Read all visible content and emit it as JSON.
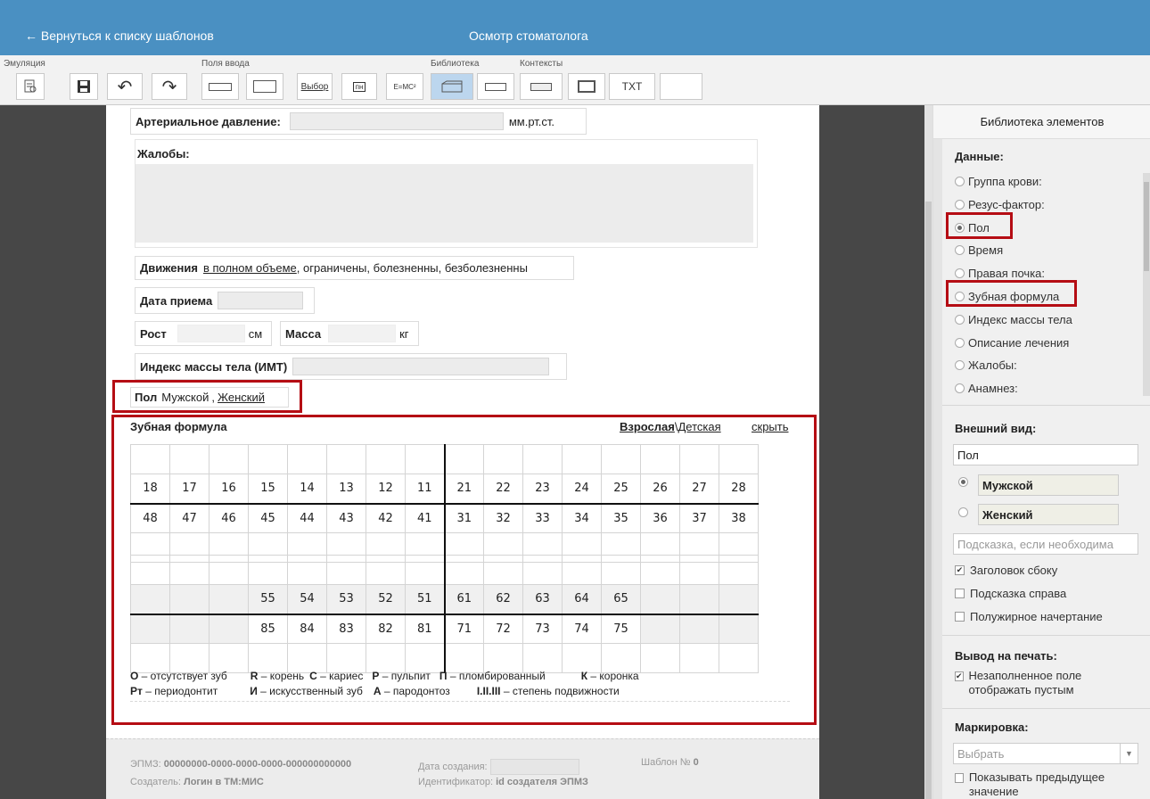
{
  "header": {
    "back_label": "← Вернуться к списку шаблонов",
    "title": "Осмотр стоматолога"
  },
  "toolbar": {
    "groups": {
      "emulation": "Эмуляция",
      "fields": "Поля ввода",
      "library": "Библиотека",
      "contexts": "Контексты"
    },
    "choice_label": "Выбор",
    "date_label": "пн",
    "formula_label": "E=MC²",
    "txt_label": "TXT"
  },
  "form": {
    "bp_label": "Артериальное давление:",
    "bp_unit": "мм.рт.ст.",
    "complaints_label": "Жалобы:",
    "movement_label": "Движения",
    "movement_options": [
      "в полном объеме",
      "ограничены",
      "болезненны",
      "безболезненны"
    ],
    "date_label": "Дата приема",
    "height_label": "Рост",
    "height_unit": "см",
    "weight_label": "Масса",
    "weight_unit": "кг",
    "bmi_label": "Индекс массы тела (ИМТ)",
    "sex_label": "Пол",
    "sex_options": [
      "Мужской",
      "Женский"
    ],
    "sex_separator": ","
  },
  "dental": {
    "title": "Зубная формула",
    "mode_adult": "Взрослая",
    "mode_sep": "\\",
    "mode_child": "Детская",
    "hide_label": "скрыть",
    "adult_upper": [
      "18",
      "17",
      "16",
      "15",
      "14",
      "13",
      "12",
      "11",
      "21",
      "22",
      "23",
      "24",
      "25",
      "26",
      "27",
      "28"
    ],
    "adult_lower": [
      "48",
      "47",
      "46",
      "45",
      "44",
      "43",
      "42",
      "41",
      "31",
      "32",
      "33",
      "34",
      "35",
      "36",
      "37",
      "38"
    ],
    "child_upper": [
      "",
      "",
      "",
      "55",
      "54",
      "53",
      "52",
      "51",
      "61",
      "62",
      "63",
      "64",
      "65",
      "",
      "",
      ""
    ],
    "child_lower": [
      "",
      "",
      "",
      "85",
      "84",
      "83",
      "82",
      "81",
      "71",
      "72",
      "73",
      "74",
      "75",
      "",
      "",
      ""
    ],
    "legend_line1": [
      {
        "k": "О",
        "t": " – отсутствует зуб"
      },
      {
        "k": "R",
        "t": " – корень"
      },
      {
        "k": "С",
        "t": " – кариес"
      },
      {
        "k": "Р",
        "t": " – пульпит"
      },
      {
        "k": "П",
        "t": " – пломбированный"
      },
      {
        "k": "К",
        "t": " – коронка"
      }
    ],
    "legend_line2": [
      {
        "k": "Рт",
        "t": " – периодонтит"
      },
      {
        "k": "И",
        "t": " – искусственный зуб"
      },
      {
        "k": "А",
        "t": " – пародонтоз"
      },
      {
        "k": "I.II.III",
        "t": " – степень подвижности"
      }
    ]
  },
  "footer": {
    "epmz_label": "ЭПМЗ:",
    "epmz_value": "00000000-0000-0000-0000-000000000000",
    "created_label": "Дата создания:",
    "template_label": "Шаблон №",
    "template_value": "0",
    "creator_label": "Создатель:",
    "creator_value": "Логин в ТМ:МИС",
    "id_label": "Идентификатор:",
    "id_value": "id создателя ЭПМЗ"
  },
  "right_panel": {
    "title": "Библиотека элементов",
    "data_title": "Данные:",
    "data_items": [
      "Группа крови:",
      "Резус-фактор:",
      "Пол",
      "Время",
      "Правая почка:",
      "Зубная формула",
      "Индекс массы тела",
      "Описание лечения",
      "Жалобы:",
      "Анамнез:"
    ],
    "appearance_title": "Внешний вид:",
    "field_name": "Пол",
    "options": [
      "Мужской",
      "Женский"
    ],
    "hint_placeholder": "Подсказка, если необходима",
    "checkboxes": [
      {
        "label": "Заголовок сбоку",
        "checked": true
      },
      {
        "label": "Подсказка справа",
        "checked": false
      },
      {
        "label": "Полужирное начертание",
        "checked": false
      }
    ],
    "print_title": "Вывод на печать:",
    "print_checkbox": "Незаполненное поле отображать пустым",
    "marking_title": "Маркировка:",
    "marking_select": "Выбрать",
    "prev_value_label": "Показывать предыдущее значение"
  },
  "colors": {
    "header": "#4a90c2",
    "highlight": "#b50d14",
    "dark_pane": "#474747"
  }
}
